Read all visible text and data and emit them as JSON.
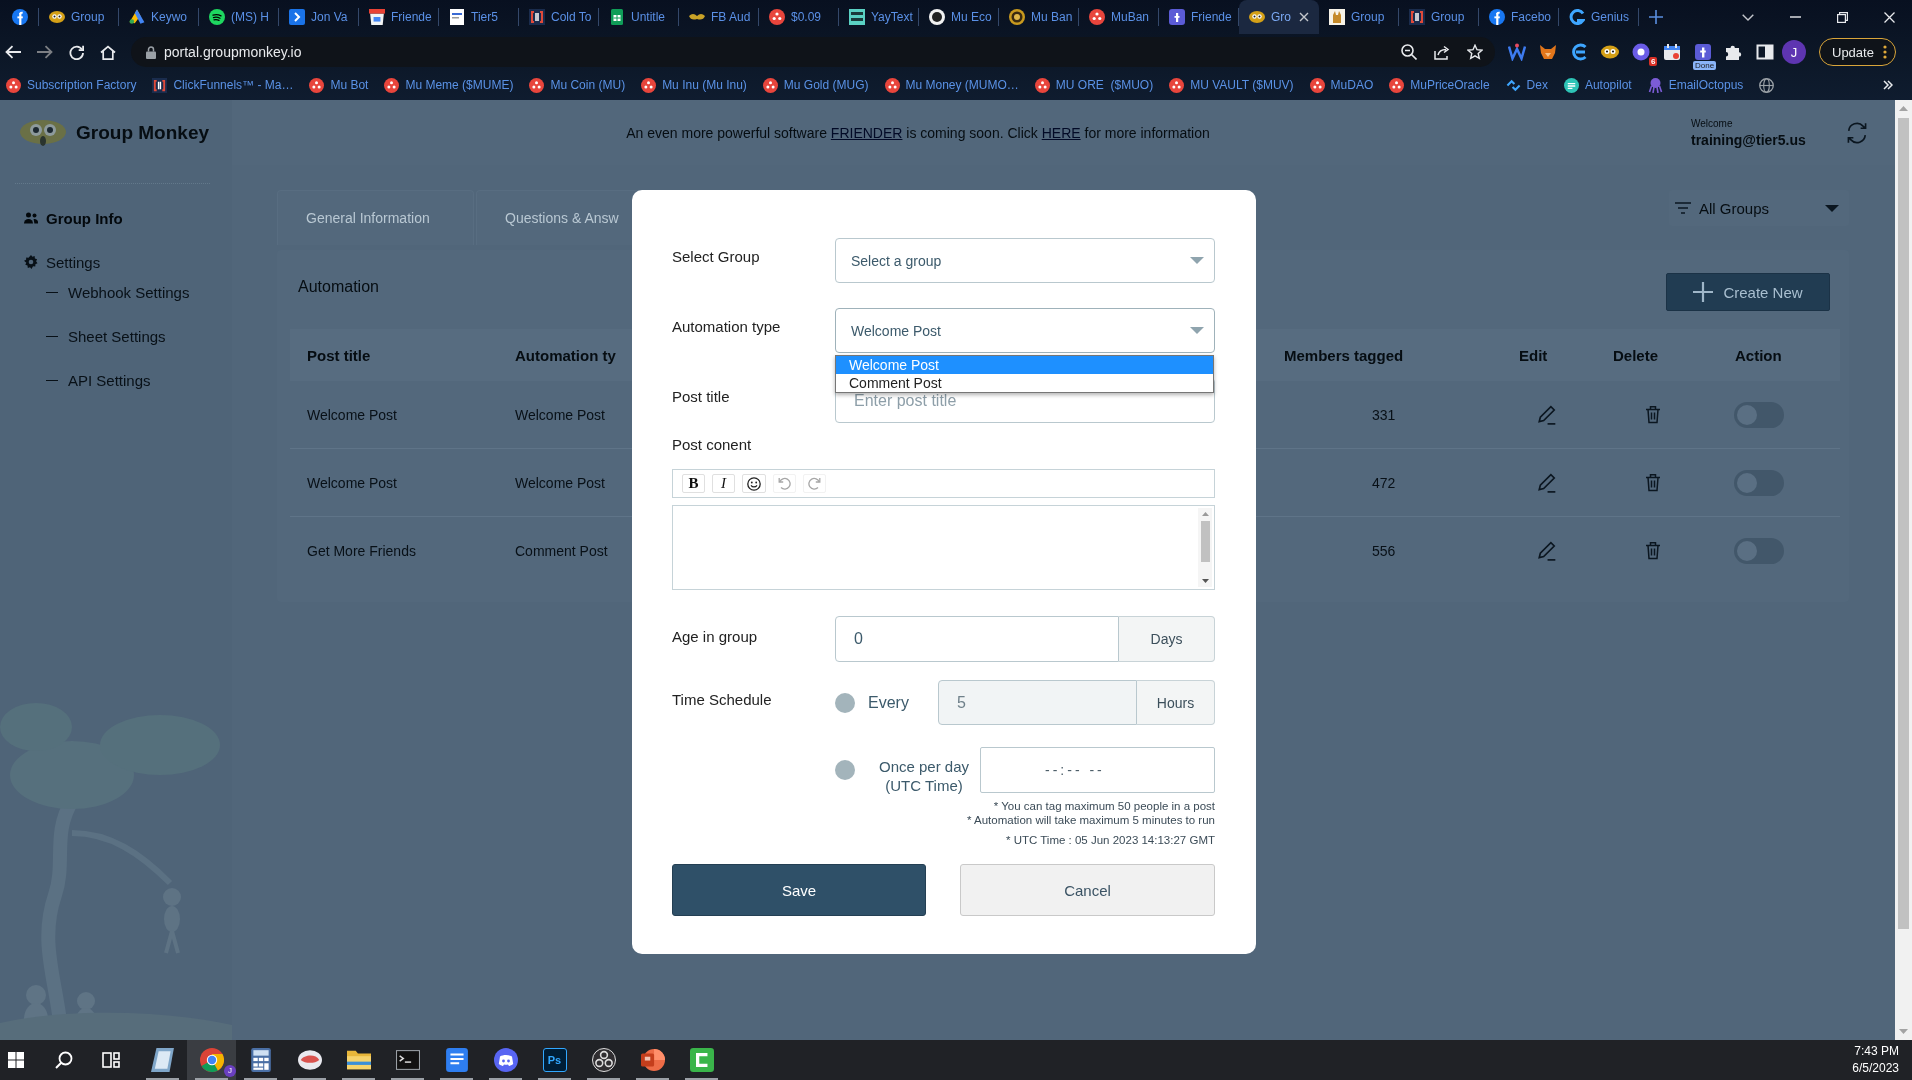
{
  "browser": {
    "tabs": [
      {
        "selected": false
      },
      {
        "title": "Group",
        "selected": false
      },
      {
        "title": "Keywo",
        "selected": false
      },
      {
        "title": "(MS) H",
        "selected": false
      },
      {
        "title": "Jon Va",
        "selected": false
      },
      {
        "title": "Friende",
        "selected": false
      },
      {
        "title": "Tier5",
        "selected": false
      },
      {
        "title": "Cold To",
        "selected": false
      },
      {
        "title": "Untitle",
        "selected": false
      },
      {
        "title": "FB Aud",
        "selected": false
      },
      {
        "title": "$0.09",
        "selected": false
      },
      {
        "title": "YayText",
        "selected": false
      },
      {
        "title": "Mu Eco",
        "selected": false
      },
      {
        "title": "Mu Ban",
        "selected": false
      },
      {
        "title": "MuBan",
        "selected": false
      },
      {
        "title": "Friende",
        "selected": false
      },
      {
        "title": "Gro",
        "selected": true
      },
      {
        "title": "Group",
        "selected": false
      },
      {
        "title": "Group",
        "selected": false
      },
      {
        "title": "Facebo",
        "selected": false
      },
      {
        "title": "Genius",
        "selected": false
      }
    ],
    "address_bar": {
      "url": "portal.groupmonkey.io"
    },
    "extensions": {
      "badge_count": "6",
      "badge_status": "Done"
    },
    "profile_initial": "J",
    "update_button": "Update",
    "bookmarks": [
      {
        "title": "Subscription Factory"
      },
      {
        "title": "ClickFunnels™ - Ma…"
      },
      {
        "title": "Mu Bot"
      },
      {
        "title": "Mu Meme ($MUME)"
      },
      {
        "title": "Mu Coin (MU)"
      },
      {
        "title": "Mu Inu (Mu Inu)"
      },
      {
        "title": "Mu Gold (MUG)"
      },
      {
        "title": "Mu Money (MUMO…"
      },
      {
        "title": "MU ORE  ($MUO)"
      },
      {
        "title": "MU VAULT ($MUV)"
      },
      {
        "title": "MuDAO"
      },
      {
        "title": "MuPriceOracle"
      },
      {
        "title": "Dex"
      },
      {
        "title": "Autopilot"
      },
      {
        "title": "EmailOctopus"
      }
    ]
  },
  "page": {
    "logo": "Group Monkey",
    "announcement": [
      {
        "kind": "text",
        "text": "An even more powerful software "
      },
      {
        "kind": "link",
        "text": "FRIENDER"
      },
      {
        "kind": "text",
        "text": " is coming soon. Click "
      },
      {
        "kind": "link",
        "text": "HERE"
      },
      {
        "kind": "text",
        "text": " for more information"
      }
    ],
    "user": {
      "greeting": "Welcome",
      "email": "training@tier5.us"
    },
    "sidebar": {
      "items": [
        {
          "label": "Group Info",
          "selected": true
        },
        {
          "label": "Settings",
          "selected": false,
          "children": [
            {
              "label": "Webhook Settings",
              "selected": false
            },
            {
              "label": "Sheet Settings",
              "selected": false
            },
            {
              "label": "API Settings",
              "selected": false
            }
          ]
        }
      ]
    },
    "tabs": [
      {
        "label": "General Information",
        "selected": false
      },
      {
        "label": "Questions & Answ",
        "selected": false
      }
    ],
    "group_filter": {
      "value": "All Groups"
    },
    "section_title": "Automation",
    "create_button": "Create New",
    "table": {
      "columns": [
        "Post title",
        "Automation ty",
        "Members tagged",
        "Edit",
        "Delete",
        "Action"
      ],
      "rows": [
        {
          "cells": [
            "Welcome Post",
            "Welcome Post",
            "331"
          ],
          "on": false
        },
        {
          "cells": [
            "Welcome Post",
            "Welcome Post",
            "472"
          ],
          "on": false
        },
        {
          "cells": [
            "Get More Friends",
            "Comment Post",
            "556"
          ],
          "on": false
        }
      ]
    }
  },
  "modal": {
    "fields": [
      {
        "kind": "select",
        "label": "Select Group",
        "value": "Select a group",
        "expanded": false
      },
      {
        "kind": "select",
        "label": "Automation type",
        "value": "Welcome Post",
        "expanded": true,
        "options": [
          {
            "label": "Welcome Post",
            "selected": true
          },
          {
            "label": "Comment Post",
            "selected": false
          }
        ]
      },
      {
        "kind": "text",
        "label": "Post title",
        "placeholder": "Enter post title"
      },
      {
        "kind": "editor",
        "label": "Post conent",
        "toolbar": [
          {
            "kind": "bold",
            "label": "B",
            "disabled": false
          },
          {
            "kind": "italic",
            "label": "I",
            "disabled": false
          },
          {
            "kind": "emoji",
            "disabled": false
          },
          {
            "kind": "undo",
            "disabled": true
          },
          {
            "kind": "redo",
            "disabled": true
          }
        ]
      },
      {
        "kind": "number",
        "label": "Age in group",
        "value": "0",
        "unit": "Days"
      },
      {
        "kind": "schedule",
        "label": "Time Schedule",
        "options": [
          {
            "kind": "interval",
            "label": "Every",
            "value": "5",
            "unit": "Hours",
            "selected": false,
            "disabled": true
          },
          {
            "kind": "daily",
            "label": "Once per day (UTC Time)",
            "placeholder": "--:-- --",
            "selected": false,
            "disabled": false
          }
        ]
      }
    ],
    "notes": [
      "* You can tag maximum 50 people in a post",
      "* Automation will take maximum 5 minutes to run",
      "* UTC Time : 05 Jun 2023 14:13:27 GMT"
    ],
    "buttons": [
      {
        "kind": "primary",
        "label": "Save"
      },
      {
        "kind": "secondary",
        "label": "Cancel"
      }
    ]
  },
  "taskbar": {
    "apps": [
      {
        "running": true,
        "selected": false
      },
      {
        "running": true,
        "selected": true,
        "badge": "J"
      },
      {
        "running": true,
        "selected": false
      },
      {
        "running": true,
        "selected": false
      },
      {
        "running": true,
        "selected": false
      },
      {
        "running": true,
        "selected": false
      },
      {
        "running": true,
        "selected": false
      },
      {
        "running": true,
        "selected": false
      },
      {
        "running": true,
        "selected": false,
        "label": "Ps"
      },
      {
        "running": true,
        "selected": false
      },
      {
        "running": true,
        "selected": false
      },
      {
        "running": true,
        "selected": false
      }
    ],
    "time": "7:43 PM",
    "date": "6/5/2023"
  }
}
